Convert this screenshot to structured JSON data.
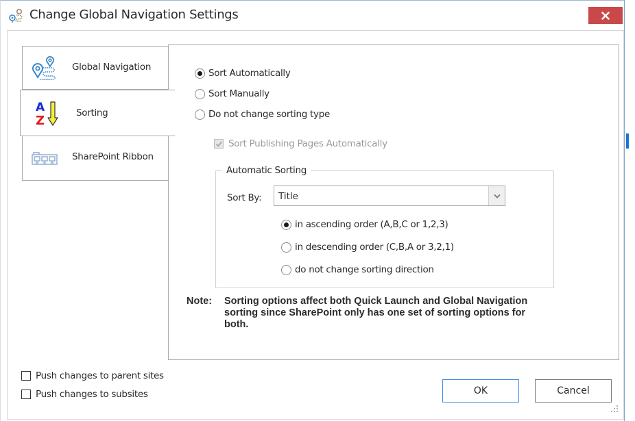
{
  "window": {
    "title": "Change Global Navigation Settings",
    "title_icon": "global-navigation-icon",
    "close_icon": "close-icon",
    "accent_close": "#c9494a"
  },
  "tabs": [
    {
      "id": "global-navigation",
      "label": "Global Navigation",
      "icon": "map-route-icon",
      "selected": false
    },
    {
      "id": "sorting",
      "label": "Sorting",
      "icon": "sort-az-icon",
      "selected": true
    },
    {
      "id": "sharepoint-ribbon",
      "label": "SharePoint Ribbon",
      "icon": "ribbon-icon",
      "selected": false
    }
  ],
  "sorting": {
    "sort_type_options": [
      {
        "label": "Sort Automatically",
        "checked": true
      },
      {
        "label": "Sort Manually",
        "checked": false
      },
      {
        "label": "Do not change sorting type",
        "checked": false
      }
    ],
    "publishing_pages": {
      "label": "Sort Publishing Pages Automatically",
      "checked": true,
      "disabled": true
    },
    "automatic_sorting": {
      "group_title": "Automatic Sorting",
      "sort_by_label": "Sort By:",
      "sort_by_value": "Title",
      "direction_options": [
        {
          "label": "in ascending order (A,B,C or 1,2,3)",
          "checked": true
        },
        {
          "label": "in descending order (C,B,A or 3,2,1)",
          "checked": false
        },
        {
          "label": "do not change sorting direction",
          "checked": false
        }
      ]
    },
    "note_label": "Note:",
    "note_text": "Sorting options affect both Quick Launch and Global Navigation sorting since SharePoint only has one set of sorting options for both."
  },
  "footer": {
    "push_parent": {
      "label": "Push changes to parent sites",
      "checked": false
    },
    "push_subsites": {
      "label": "Push changes to subsites",
      "checked": false
    },
    "ok_label": "OK",
    "cancel_label": "Cancel"
  }
}
